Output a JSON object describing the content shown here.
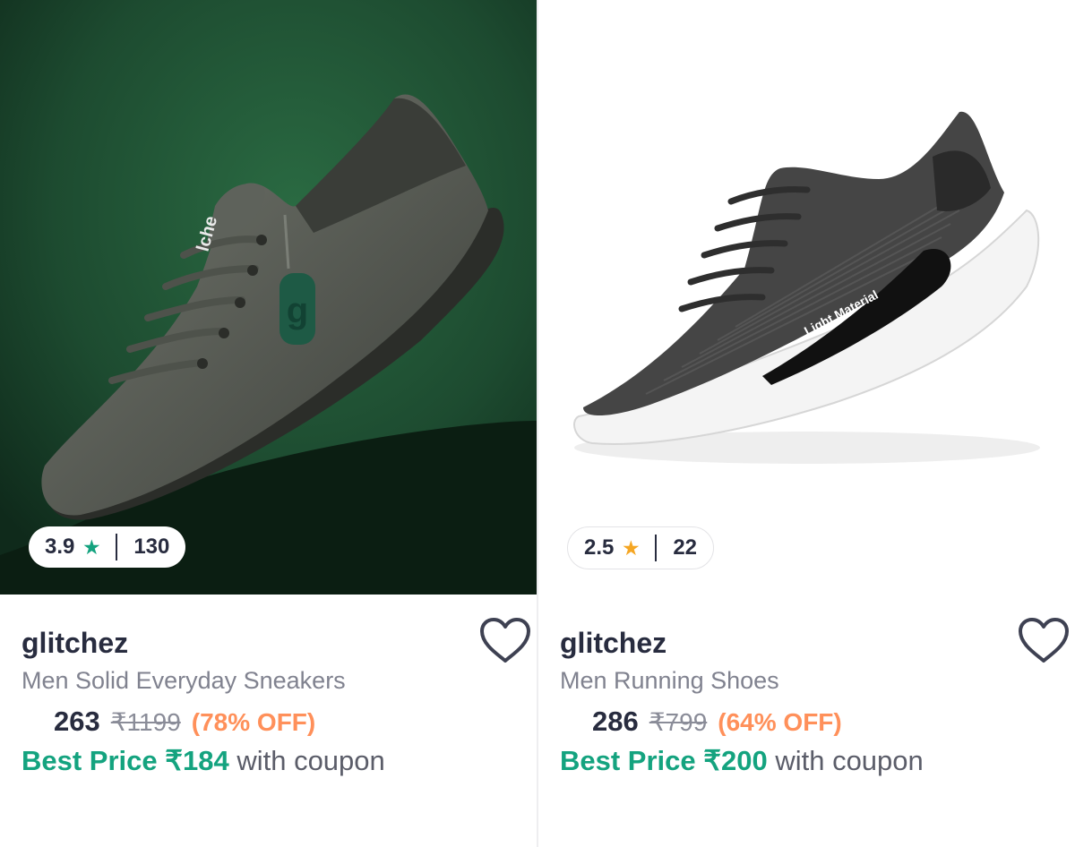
{
  "products": [
    {
      "rating": "3.9",
      "rating_count": "130",
      "star_color": "#14a37f",
      "brand": "glitchez",
      "title": "Men Solid Everyday Sneakers",
      "price": "263",
      "mrp": "₹1199",
      "discount": "(78% OFF)",
      "best_price_label": "Best Price ₹184",
      "best_price_suffix": "with coupon",
      "image_bg": "#1f4d33",
      "logo_text": "lche",
      "tag_text": "g"
    },
    {
      "rating": "2.5",
      "rating_count": "22",
      "star_color": "#f5a623",
      "brand": "glitchez",
      "title": "Men Running Shoes",
      "price": "286",
      "mrp": "₹799",
      "discount": "(64% OFF)",
      "best_price_label": "Best Price ₹200",
      "best_price_suffix": "with coupon",
      "image_bg": "#ffffff",
      "sole_text": "Light Material"
    }
  ],
  "icons": {
    "rating_star": "star-icon",
    "wishlist": "heart-outline-icon"
  }
}
